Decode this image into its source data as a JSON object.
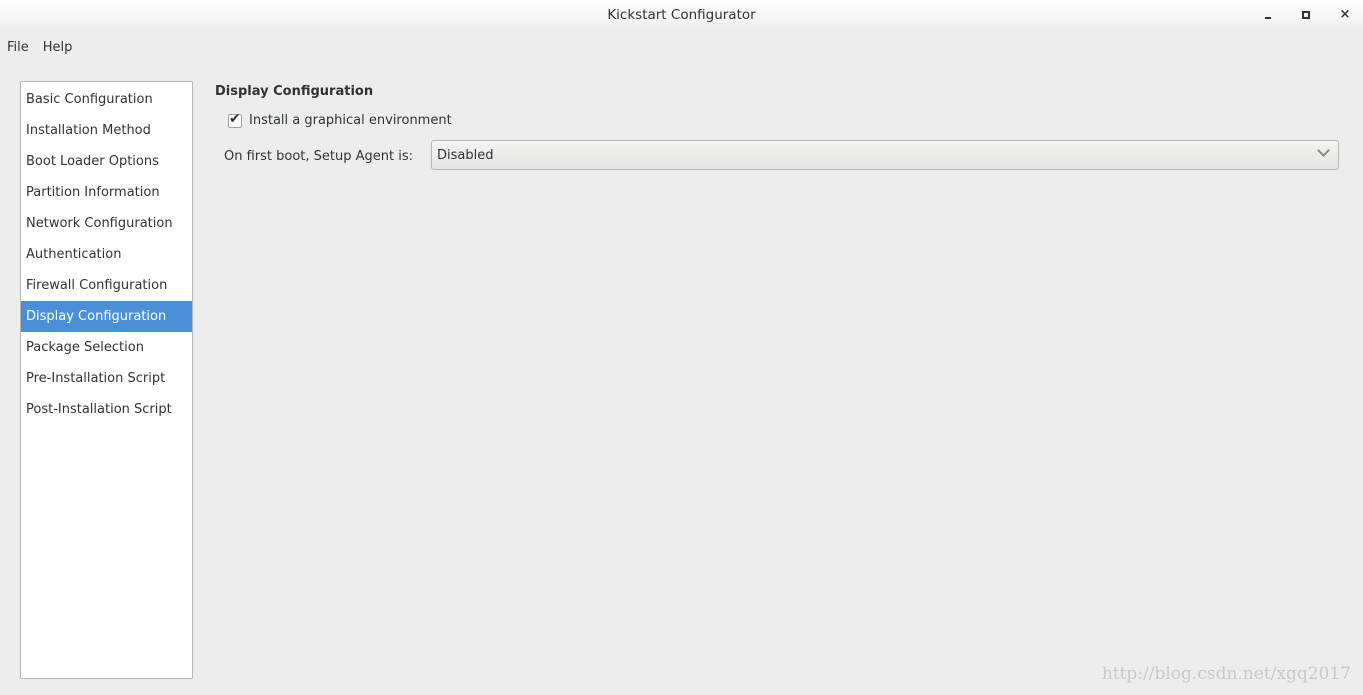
{
  "window": {
    "title": "Kickstart Configurator",
    "minimize": "minimize-icon",
    "maximize": "maximize-icon",
    "close": "×"
  },
  "menu": [
    "File",
    "Help"
  ],
  "sidebar": {
    "items": [
      {
        "label": "Basic Configuration"
      },
      {
        "label": "Installation Method"
      },
      {
        "label": "Boot Loader Options"
      },
      {
        "label": "Partition Information"
      },
      {
        "label": "Network Configuration"
      },
      {
        "label": "Authentication"
      },
      {
        "label": "Firewall Configuration"
      },
      {
        "label": "Display Configuration",
        "selected": true
      },
      {
        "label": "Package Selection"
      },
      {
        "label": "Pre-Installation Script"
      },
      {
        "label": "Post-Installation Script"
      }
    ],
    "selected_color": "#4a90d9"
  },
  "main": {
    "heading": "Display Configuration",
    "install_graphical": {
      "label": "Install a graphical environment",
      "checked": true
    },
    "setup_agent": {
      "label": "On first boot, Setup Agent is:",
      "value": "Disabled"
    }
  },
  "watermark": "http://blog.csdn.net/xgq2017"
}
